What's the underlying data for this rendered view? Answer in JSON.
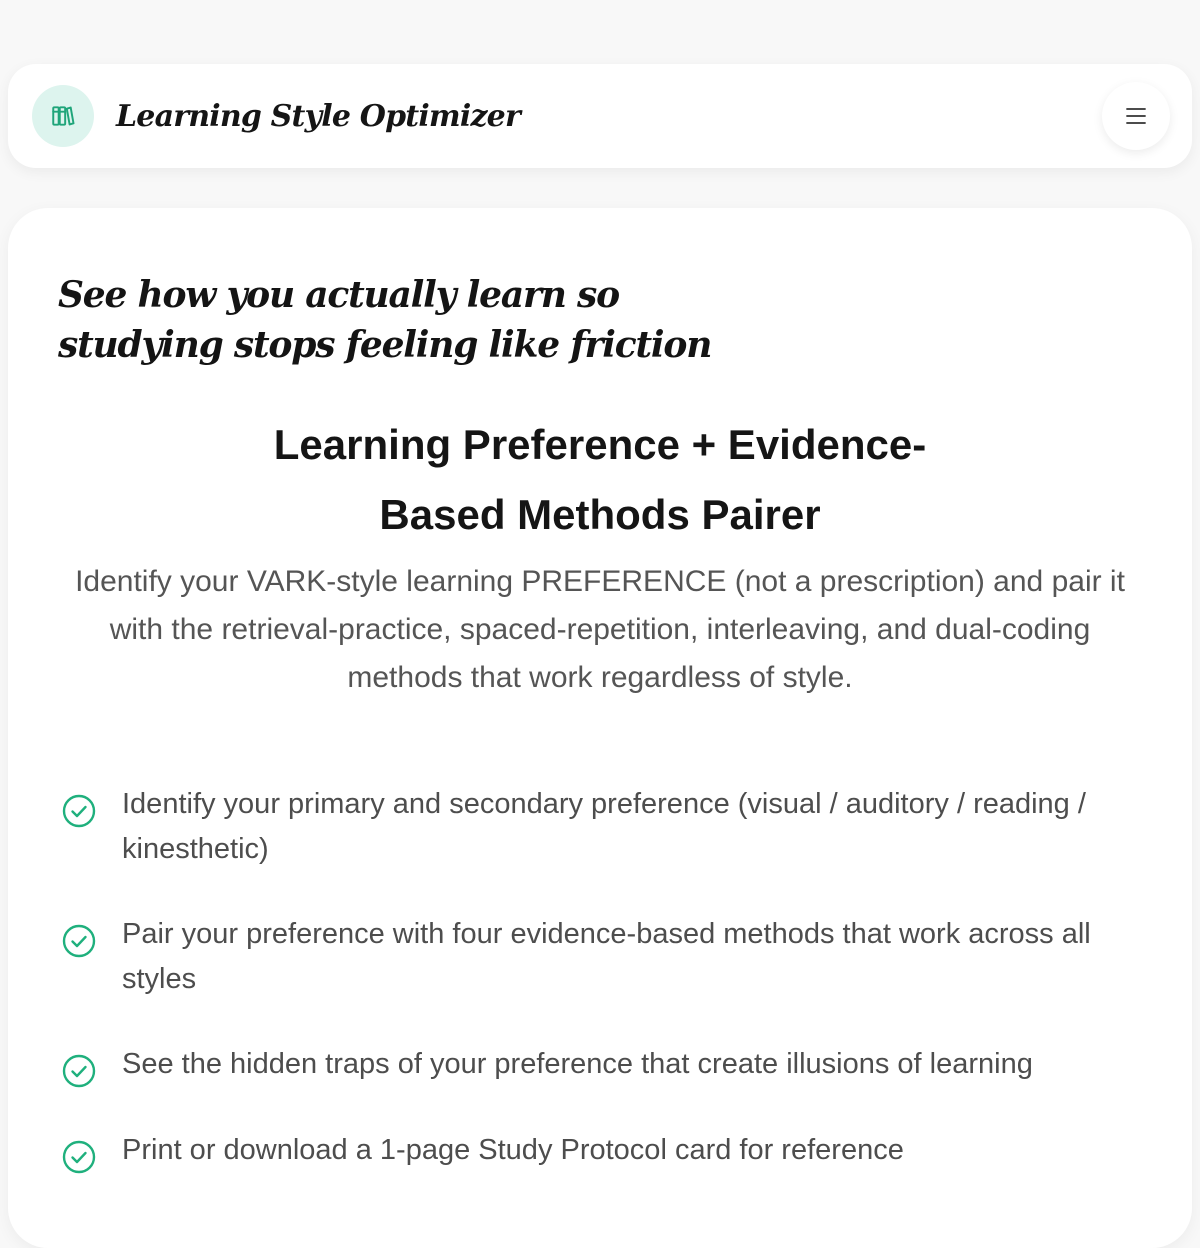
{
  "header": {
    "title": "Learning Style Optimizer",
    "logo_icon": "books-icon",
    "menu_icon": "hamburger-menu-icon"
  },
  "hero": {
    "heading_line1": "See how you actually learn so",
    "heading_line2": "studying stops feeling like friction"
  },
  "tool": {
    "title": "Learning Preference + Evidence-Based Methods Pairer",
    "description": "Identify your VARK-style learning PREFERENCE (not a prescription) and pair it with the retrieval-practice, spaced-repetition, interleaving, and dual-coding methods that work regardless of style."
  },
  "features": [
    "Identify your primary and secondary preference (visual / auditory / reading / kinesthetic)",
    "Pair your preference with four evidence-based methods that work across all styles",
    "See the hidden traps of your preference that create illusions of learning",
    "Print or download a 1-page Study Protocol card for reference"
  ],
  "colors": {
    "accent": "#1fb07d",
    "logo_bg": "#ddf4ee",
    "text_dark": "#151515",
    "text_muted": "#555555",
    "page_bg": "#f8f8f8"
  }
}
